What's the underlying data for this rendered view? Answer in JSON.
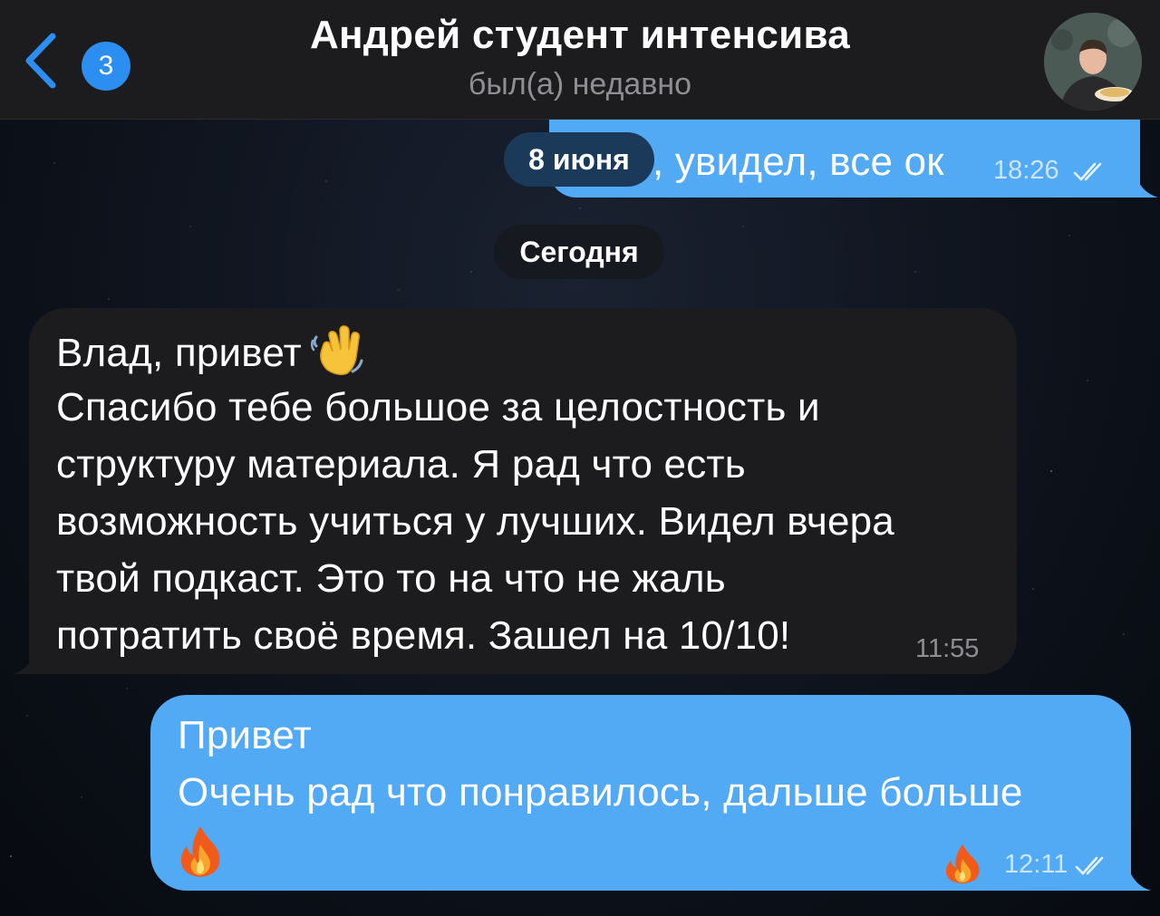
{
  "header": {
    "back_count": "3",
    "title": "Андрей студент интенсива",
    "status": "был(а) недавно"
  },
  "date_pills": {
    "june": "8 июня",
    "today": "Сегодня"
  },
  "messages": [
    {
      "direction": "outgoing",
      "text": ", увидел, все ок",
      "time": "18:26",
      "read": true
    },
    {
      "direction": "incoming",
      "lines": [
        "Влад, привет",
        "Спасибо тебе большое за целостность и",
        "структуру материала. Я рад что есть",
        "возможность учиться у лучших. Видел вчера",
        "твой  подкаст. Это то на что не жаль",
        "потратить своё время. Зашел на 10/10!"
      ],
      "emoji": "waving-hand",
      "time": "11:55"
    },
    {
      "direction": "outgoing",
      "lines": [
        "Привет",
        "Очень рад что понравилось, дальше больше"
      ],
      "emoji": "fire",
      "reaction": "fire",
      "time": "12:11",
      "read": true
    }
  ],
  "colors": {
    "outgoing_bubble": "#52a9f4",
    "incoming_bubble": "#1c1c1e",
    "accent": "#2b8ef0"
  }
}
